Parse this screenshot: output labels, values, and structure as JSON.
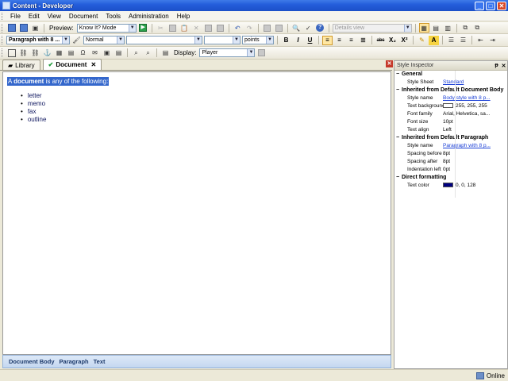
{
  "window": {
    "title": "Content - Developer",
    "min": "_",
    "max": "□",
    "close": "✕"
  },
  "menu": [
    "File",
    "Edit",
    "View",
    "Document",
    "Tools",
    "Administration",
    "Help"
  ],
  "toolbar1": {
    "preview_label": "Preview:",
    "preview_mode": "Know It? Mode",
    "view_select": "Details view"
  },
  "toolbar2": {
    "style": "Paragraph with 8 ...",
    "char_style": "Normal",
    "font": "",
    "size": "",
    "units": "points",
    "bold": "B",
    "italic": "I",
    "underline": "U",
    "strike": "abc",
    "sub": "X₂",
    "sup": "X²",
    "font_color": "A"
  },
  "toolbar3": {
    "display_label": "Display:",
    "display_value": "Player"
  },
  "tabs": [
    {
      "label": "Library",
      "icon": "book-icon",
      "active": false
    },
    {
      "label": "Document",
      "icon": "check-icon",
      "active": true,
      "close": "✕"
    }
  ],
  "editor": {
    "paragraph_prefix": "A ",
    "paragraph_bold": "document",
    "paragraph_rest": " is any of the following:",
    "items": [
      "letter",
      "memo",
      "fax",
      "outline"
    ]
  },
  "pathbar": [
    "Document Body",
    "Paragraph",
    "Text"
  ],
  "inspector": {
    "title": "Style Inspector",
    "pin": "ᵽ",
    "close": "✕",
    "groups": [
      {
        "title": "General",
        "rows": [
          {
            "key": "Style Sheet",
            "value": "Standard",
            "link": true
          }
        ]
      },
      {
        "title": "Inherited from Default Document Body",
        "rows": [
          {
            "key": "Style name",
            "value": "Body style with 8 p...",
            "link": true
          },
          {
            "key": "Text background c",
            "value": "255, 255, 255",
            "swatch": "#ffffff"
          },
          {
            "key": "Font family",
            "value": "Arial, Helvetica, sa..."
          },
          {
            "key": "Font size",
            "value": "10pt"
          },
          {
            "key": "Text align",
            "value": "Left"
          }
        ]
      },
      {
        "title": "Inherited from Default Paragraph",
        "rows": [
          {
            "key": "Style name",
            "value": "Paragraph with 8 p...",
            "link": true
          },
          {
            "key": "Spacing before",
            "value": "8pt"
          },
          {
            "key": "Spacing after",
            "value": "8pt"
          },
          {
            "key": "Indentation left",
            "value": "0pt"
          }
        ]
      },
      {
        "title": "Direct formatting",
        "rows": [
          {
            "key": "Text color",
            "value": "0, 0, 128",
            "swatch": "#000080"
          }
        ]
      }
    ]
  },
  "status": {
    "text": "Online"
  },
  "colors": {
    "titlebar": "#245edb",
    "selection": "#3467cc",
    "link": "#1a3fd6",
    "text_color_swatch": "#000080"
  }
}
